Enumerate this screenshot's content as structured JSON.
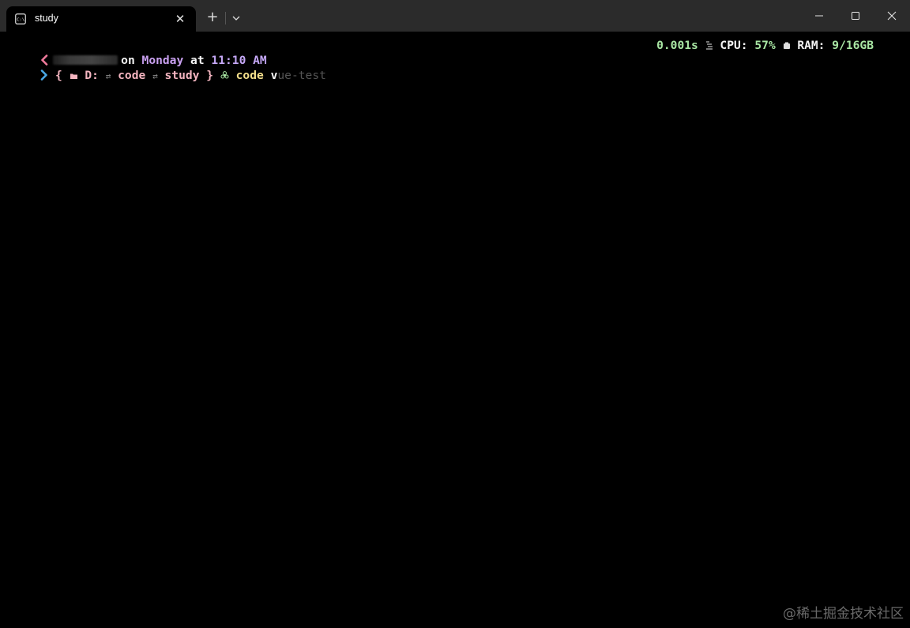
{
  "window": {
    "tab_title": "study",
    "tab_icon": "terminal-icon",
    "close_tab_glyph": "✕",
    "new_tab_glyph": "+",
    "controls": [
      "minimize-icon",
      "maximize-icon",
      "close-icon"
    ]
  },
  "prompt": {
    "line1": {
      "on": "on",
      "day": "Monday",
      "at": "at",
      "time": "11:10 AM"
    },
    "line2": {
      "open_brace": "{",
      "drive": "D:",
      "sep1": "⇄",
      "dir1": "code",
      "sep2": "⇄",
      "dir2": "study",
      "close_brace": "}",
      "command": "code",
      "typed": "v",
      "suggestion": "ue-test"
    }
  },
  "status": {
    "duration": "0.001s",
    "cpu_label": "CPU:",
    "cpu_value": "57%",
    "ram_label": "RAM:",
    "ram_value": "9/16GB"
  },
  "watermark": "@稀土掘金技术社区",
  "colors": {
    "chevron_back": "#f07a9c",
    "chevron_prompt": "#4aa8e6",
    "time": "#c4a7f5",
    "green": "#a8e6a3",
    "path": "#f4b5c0",
    "command": "#f5e08c"
  }
}
